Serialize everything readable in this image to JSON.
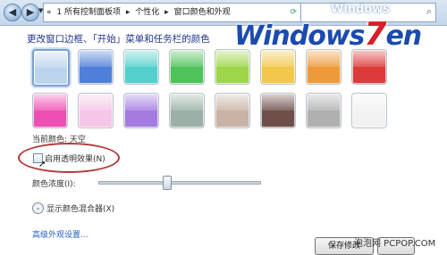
{
  "nav": {
    "back_icon": "back-arrow-icon",
    "forward_icon": "forward-arrow-icon",
    "dropdown_icon": "chevron-down-icon"
  },
  "address_bar": {
    "segments": [
      "«",
      "1 所有控制面板项",
      "▸",
      "个性化",
      "▸",
      "窗口颜色和外观"
    ],
    "refresh_icon": "refresh-icon"
  },
  "search": {
    "placeholder": "",
    "icon": "search-icon"
  },
  "heading": "更改窗口边框、「开始」菜单和任务栏的颜色",
  "swatches_row1": [
    "#bcd4ee",
    "#4f7fd8",
    "#54d0cc",
    "#4fc25a",
    "#9ed64a",
    "#f2c84c",
    "#ee9a3a",
    "#dd3a3a"
  ],
  "swatches_row2": [
    "#ee4fb2",
    "#f5c6e6",
    "#a47be0",
    "#9bb0a6",
    "#c9b3a6",
    "#6e4f4a",
    "#b0b0b0",
    "#f2f2f2"
  ],
  "current_color_label": "当前颜色: 天空",
  "transparency_label": "启用透明效果(N)",
  "intensity_label": "颜色浓度(I):",
  "intensity_value": 0.42,
  "color_mixer_label": "显示颜色混合器(X)",
  "advanced_link": "高级外观设置...",
  "save_button": "保存修改",
  "watermark": {
    "logo_prefix": "Windows",
    "logo_seven": "7",
    "logo_suffix": "en",
    "top_text": "Windows",
    "site_text": "泡泡网 PCPOP.COM"
  }
}
